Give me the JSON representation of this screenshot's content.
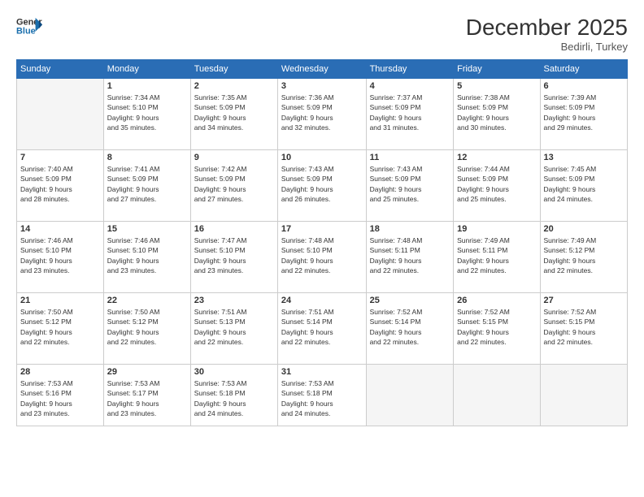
{
  "header": {
    "logo_line1": "General",
    "logo_line2": "Blue",
    "month": "December 2025",
    "location": "Bedirli, Turkey"
  },
  "days_of_week": [
    "Sunday",
    "Monday",
    "Tuesday",
    "Wednesday",
    "Thursday",
    "Friday",
    "Saturday"
  ],
  "weeks": [
    [
      {
        "num": "",
        "info": ""
      },
      {
        "num": "1",
        "info": "Sunrise: 7:34 AM\nSunset: 5:10 PM\nDaylight: 9 hours\nand 35 minutes."
      },
      {
        "num": "2",
        "info": "Sunrise: 7:35 AM\nSunset: 5:09 PM\nDaylight: 9 hours\nand 34 minutes."
      },
      {
        "num": "3",
        "info": "Sunrise: 7:36 AM\nSunset: 5:09 PM\nDaylight: 9 hours\nand 32 minutes."
      },
      {
        "num": "4",
        "info": "Sunrise: 7:37 AM\nSunset: 5:09 PM\nDaylight: 9 hours\nand 31 minutes."
      },
      {
        "num": "5",
        "info": "Sunrise: 7:38 AM\nSunset: 5:09 PM\nDaylight: 9 hours\nand 30 minutes."
      },
      {
        "num": "6",
        "info": "Sunrise: 7:39 AM\nSunset: 5:09 PM\nDaylight: 9 hours\nand 29 minutes."
      }
    ],
    [
      {
        "num": "7",
        "info": "Sunrise: 7:40 AM\nSunset: 5:09 PM\nDaylight: 9 hours\nand 28 minutes."
      },
      {
        "num": "8",
        "info": "Sunrise: 7:41 AM\nSunset: 5:09 PM\nDaylight: 9 hours\nand 27 minutes."
      },
      {
        "num": "9",
        "info": "Sunrise: 7:42 AM\nSunset: 5:09 PM\nDaylight: 9 hours\nand 27 minutes."
      },
      {
        "num": "10",
        "info": "Sunrise: 7:43 AM\nSunset: 5:09 PM\nDaylight: 9 hours\nand 26 minutes."
      },
      {
        "num": "11",
        "info": "Sunrise: 7:43 AM\nSunset: 5:09 PM\nDaylight: 9 hours\nand 25 minutes."
      },
      {
        "num": "12",
        "info": "Sunrise: 7:44 AM\nSunset: 5:09 PM\nDaylight: 9 hours\nand 25 minutes."
      },
      {
        "num": "13",
        "info": "Sunrise: 7:45 AM\nSunset: 5:09 PM\nDaylight: 9 hours\nand 24 minutes."
      }
    ],
    [
      {
        "num": "14",
        "info": "Sunrise: 7:46 AM\nSunset: 5:10 PM\nDaylight: 9 hours\nand 23 minutes."
      },
      {
        "num": "15",
        "info": "Sunrise: 7:46 AM\nSunset: 5:10 PM\nDaylight: 9 hours\nand 23 minutes."
      },
      {
        "num": "16",
        "info": "Sunrise: 7:47 AM\nSunset: 5:10 PM\nDaylight: 9 hours\nand 23 minutes."
      },
      {
        "num": "17",
        "info": "Sunrise: 7:48 AM\nSunset: 5:10 PM\nDaylight: 9 hours\nand 22 minutes."
      },
      {
        "num": "18",
        "info": "Sunrise: 7:48 AM\nSunset: 5:11 PM\nDaylight: 9 hours\nand 22 minutes."
      },
      {
        "num": "19",
        "info": "Sunrise: 7:49 AM\nSunset: 5:11 PM\nDaylight: 9 hours\nand 22 minutes."
      },
      {
        "num": "20",
        "info": "Sunrise: 7:49 AM\nSunset: 5:12 PM\nDaylight: 9 hours\nand 22 minutes."
      }
    ],
    [
      {
        "num": "21",
        "info": "Sunrise: 7:50 AM\nSunset: 5:12 PM\nDaylight: 9 hours\nand 22 minutes."
      },
      {
        "num": "22",
        "info": "Sunrise: 7:50 AM\nSunset: 5:12 PM\nDaylight: 9 hours\nand 22 minutes."
      },
      {
        "num": "23",
        "info": "Sunrise: 7:51 AM\nSunset: 5:13 PM\nDaylight: 9 hours\nand 22 minutes."
      },
      {
        "num": "24",
        "info": "Sunrise: 7:51 AM\nSunset: 5:14 PM\nDaylight: 9 hours\nand 22 minutes."
      },
      {
        "num": "25",
        "info": "Sunrise: 7:52 AM\nSunset: 5:14 PM\nDaylight: 9 hours\nand 22 minutes."
      },
      {
        "num": "26",
        "info": "Sunrise: 7:52 AM\nSunset: 5:15 PM\nDaylight: 9 hours\nand 22 minutes."
      },
      {
        "num": "27",
        "info": "Sunrise: 7:52 AM\nSunset: 5:15 PM\nDaylight: 9 hours\nand 22 minutes."
      }
    ],
    [
      {
        "num": "28",
        "info": "Sunrise: 7:53 AM\nSunset: 5:16 PM\nDaylight: 9 hours\nand 23 minutes."
      },
      {
        "num": "29",
        "info": "Sunrise: 7:53 AM\nSunset: 5:17 PM\nDaylight: 9 hours\nand 23 minutes."
      },
      {
        "num": "30",
        "info": "Sunrise: 7:53 AM\nSunset: 5:18 PM\nDaylight: 9 hours\nand 24 minutes."
      },
      {
        "num": "31",
        "info": "Sunrise: 7:53 AM\nSunset: 5:18 PM\nDaylight: 9 hours\nand 24 minutes."
      },
      {
        "num": "",
        "info": ""
      },
      {
        "num": "",
        "info": ""
      },
      {
        "num": "",
        "info": ""
      }
    ]
  ]
}
